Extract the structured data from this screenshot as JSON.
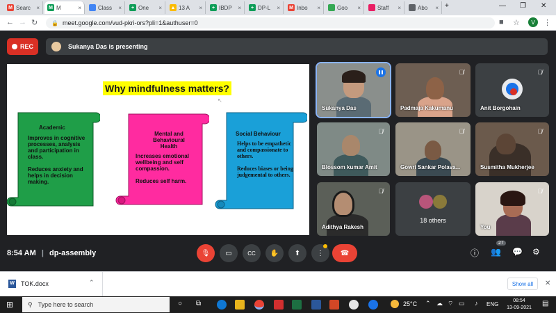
{
  "browser": {
    "tabs": [
      {
        "label": "Searc",
        "fav": "M",
        "color": "#ea4335"
      },
      {
        "label": "M",
        "fav": "M",
        "color": "#0f9d58",
        "active": true
      },
      {
        "label": "Class",
        "fav": "",
        "color": "#4285f4"
      },
      {
        "label": "One",
        "fav": "+",
        "color": "#0f9d58"
      },
      {
        "label": "13 A",
        "fav": "▲",
        "color": "#fbbc04"
      },
      {
        "label": "IBDP",
        "fav": "+",
        "color": "#0f9d58"
      },
      {
        "label": "DP-L",
        "fav": "+",
        "color": "#0f9d58"
      },
      {
        "label": "Inbo",
        "fav": "M",
        "color": "#ea4335"
      },
      {
        "label": "Goo",
        "fav": "",
        "color": "#34a853"
      },
      {
        "label": "Staff",
        "fav": "",
        "color": "#e91e63"
      },
      {
        "label": "Abo",
        "fav": "",
        "color": "#5f6368"
      }
    ],
    "new_tab": "+",
    "url": "meet.google.com/vud-pkri-ors?pli=1&authuser=0",
    "profile_initial": "V"
  },
  "meet": {
    "rec_label": "REC",
    "presenting_text": "Sukanya Das is presenting",
    "meeting_time": "8:54 AM",
    "meeting_code": "dp-assembly",
    "participants_count": "27",
    "others_label": "18 others"
  },
  "slide": {
    "title": "Why mindfulness matters?",
    "scrolls": [
      {
        "heading": "Academic",
        "body": "Improves in cognitive processes, analysis and participation in class.\n\nReduces anxiety and helps in decision making.",
        "color": "#1f9e48"
      },
      {
        "heading": "Mental and Behavioural Health",
        "body": "Increases emotional wellbeing and self compassion.\n\nReduces self harm.",
        "color": "#ff2ba0"
      },
      {
        "heading": "Social Behaviour",
        "body": "Helps to be empathetic and compassionate to others.\n\nReduces biases or being judgemental to others.",
        "color": "#1aa0d8"
      }
    ]
  },
  "participants": [
    {
      "name": "Sukanya Das",
      "speaking": true
    },
    {
      "name": "Padmaja Kakumanu"
    },
    {
      "name": "Anit Borgohain"
    },
    {
      "name": "Blossom kumar Amit"
    },
    {
      "name": "Gowri Sankar Polava..."
    },
    {
      "name": "Susmitha Mukherjee"
    },
    {
      "name": "Adithya Rakesh"
    },
    {
      "name": "You"
    }
  ],
  "downloads": {
    "file": "TOK.docx",
    "show_all": "Show all"
  },
  "taskbar": {
    "search_placeholder": "Type here to search",
    "weather": "25°C",
    "lang": "ENG",
    "time": "08:54",
    "date": "13-09-2021"
  }
}
